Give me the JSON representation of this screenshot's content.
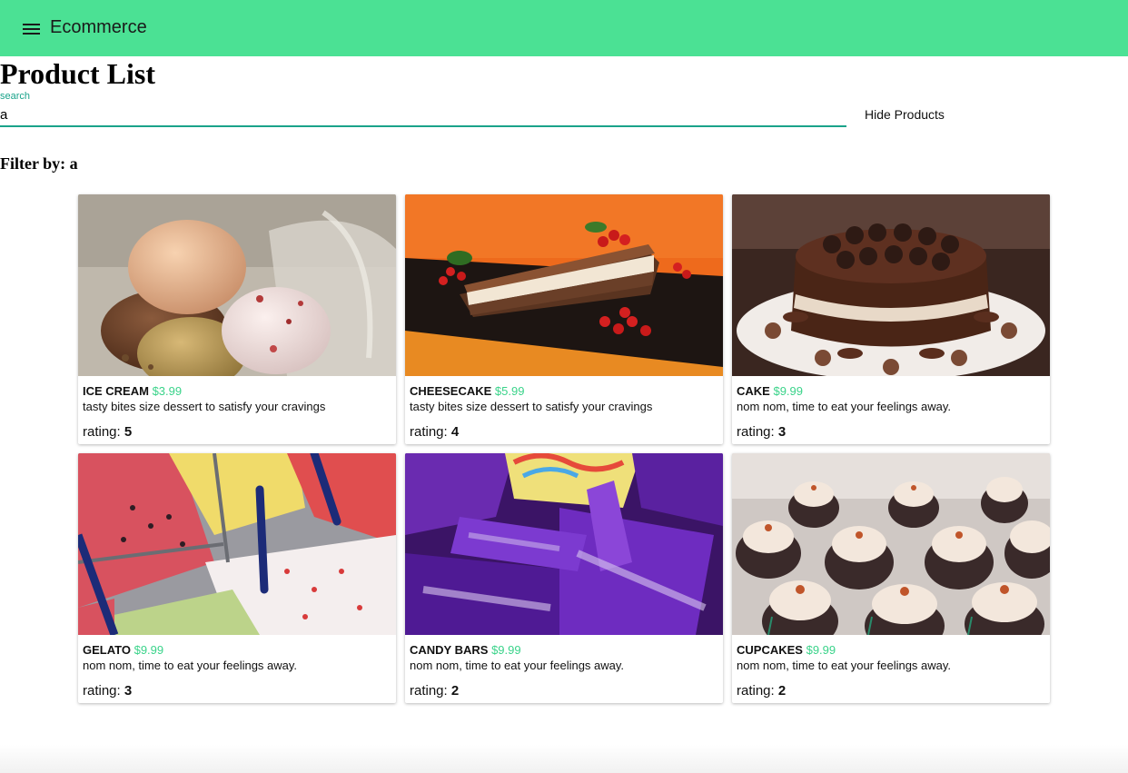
{
  "appbar": {
    "title": "Ecommerce",
    "color": "#4be194"
  },
  "page": {
    "title": "Product List"
  },
  "search": {
    "label": "search",
    "value": "a"
  },
  "hide_button": {
    "label": "Hide Products"
  },
  "filter": {
    "prefix": "Filter by: ",
    "value": "a"
  },
  "rating_label": "rating: ",
  "products": [
    {
      "name": "ICE CREAM",
      "price": "$3.99",
      "description": "tasty bites size dessert to satisfy your cravings",
      "rating": "5"
    },
    {
      "name": "CHEESECAKE",
      "price": "$5.99",
      "description": "tasty bites size dessert to satisfy your cravings",
      "rating": "4"
    },
    {
      "name": "CAKE",
      "price": "$9.99",
      "description": "nom nom, time to eat your feelings away.",
      "rating": "3"
    },
    {
      "name": "GELATO",
      "price": "$9.99",
      "description": "nom nom, time to eat your feelings away.",
      "rating": "3"
    },
    {
      "name": "CANDY BARS",
      "price": "$9.99",
      "description": "nom nom, time to eat your feelings away.",
      "rating": "2"
    },
    {
      "name": "CUPCAKES",
      "price": "$9.99",
      "description": "nom nom, time to eat your feelings away.",
      "rating": "2"
    }
  ]
}
